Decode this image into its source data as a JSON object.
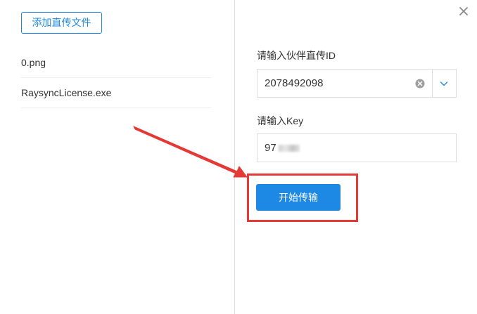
{
  "left_panel": {
    "add_button_label": "添加直传文件",
    "files": [
      {
        "name": "0.png"
      },
      {
        "name": "RaysyncLicense.exe"
      }
    ]
  },
  "right_panel": {
    "partner_id_label": "请输入伙伴直传ID",
    "partner_id_value": "2078492098",
    "key_label": "请输入Key",
    "key_value": "97",
    "start_button_label": "开始传输"
  },
  "icons": {
    "close": "close-icon",
    "clear": "clear-icon",
    "dropdown": "chevron-down-icon"
  },
  "colors": {
    "accent": "#1e88e5",
    "annotation": "#e53935",
    "divider": "#dcdcdc"
  }
}
